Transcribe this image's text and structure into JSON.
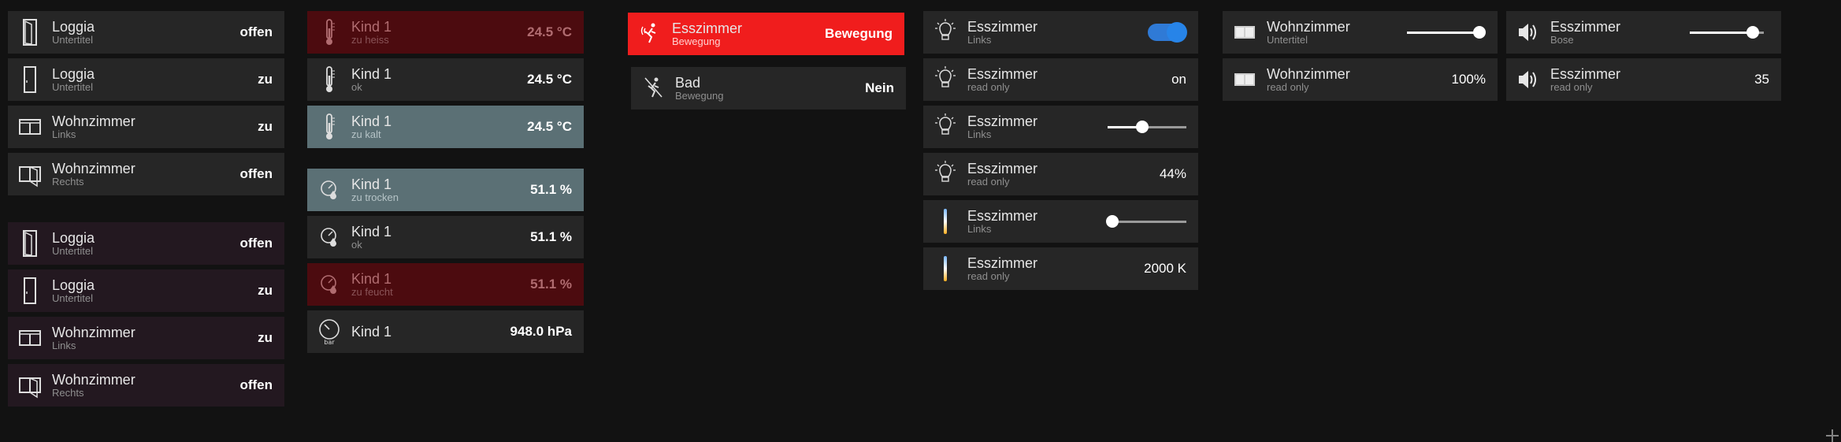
{
  "col1": [
    {
      "name": "Loggia",
      "sub": "Untertitel",
      "value": "offen",
      "icon": "door-open-icon"
    },
    {
      "name": "Loggia",
      "sub": "Untertitel",
      "value": "zu",
      "icon": "door-closed-icon"
    },
    {
      "name": "Wohnzimmer",
      "sub": "Links",
      "value": "zu",
      "icon": "window-closed-icon"
    },
    {
      "name": "Wohnzimmer",
      "sub": "Rechts",
      "value": "offen",
      "icon": "window-open-icon"
    }
  ],
  "col1b": [
    {
      "name": "Loggia",
      "sub": "Untertitel",
      "value": "offen",
      "icon": "door-open-icon"
    },
    {
      "name": "Loggia",
      "sub": "Untertitel",
      "value": "zu",
      "icon": "door-closed-icon"
    },
    {
      "name": "Wohnzimmer",
      "sub": "Links",
      "value": "zu",
      "icon": "window-closed-icon"
    },
    {
      "name": "Wohnzimmer",
      "sub": "Rechts",
      "value": "offen",
      "icon": "window-open-icon"
    }
  ],
  "col2": [
    {
      "name": "Kind 1",
      "sub": "zu heiss",
      "value": "24.5 °C",
      "icon": "thermometer-icon"
    },
    {
      "name": "Kind 1",
      "sub": "ok",
      "value": "24.5 °C",
      "icon": "thermometer-icon"
    },
    {
      "name": "Kind 1",
      "sub": "zu kalt",
      "value": "24.5 °C",
      "icon": "thermometer-icon"
    }
  ],
  "col2b": [
    {
      "name": "Kind 1",
      "sub": "zu trocken",
      "value": "51.1 %",
      "icon": "humidity-icon"
    },
    {
      "name": "Kind 1",
      "sub": "ok",
      "value": "51.1 %",
      "icon": "humidity-icon"
    },
    {
      "name": "Kind 1",
      "sub": "zu feucht",
      "value": "51.1 %",
      "icon": "humidity-icon"
    },
    {
      "name": "Kind 1",
      "sub": "",
      "value": "948.0 hPa",
      "icon": "barometer-icon",
      "icon_text": "bar"
    }
  ],
  "motion": [
    {
      "name": "Esszimmer",
      "sub": "Bewegung",
      "value": "Bewegung",
      "icon": "motion-active-icon"
    },
    {
      "name": "Bad",
      "sub": "Bewegung",
      "value": "Nein",
      "icon": "motion-inactive-icon"
    }
  ],
  "lights": [
    {
      "name": "Esszimmer",
      "sub": "Links",
      "control": "toggle",
      "state": "on",
      "icon": "light-bulb-icon"
    },
    {
      "name": "Esszimmer",
      "sub": "read only",
      "value": "on",
      "icon": "light-bulb-icon"
    },
    {
      "name": "Esszimmer",
      "sub": "Links",
      "control": "slider",
      "level": 0.44,
      "icon": "light-bulb-icon"
    },
    {
      "name": "Esszimmer",
      "sub": "read only",
      "value": "44%",
      "icon": "light-bulb-icon"
    },
    {
      "name": "Esszimmer",
      "sub": "Links",
      "control": "slider",
      "level": 0.0,
      "icon": "color-temperature-icon"
    },
    {
      "name": "Esszimmer",
      "sub": "read only",
      "value": "2000 K",
      "icon": "color-temperature-icon"
    }
  ],
  "blinds": [
    {
      "name": "Wohnzimmer",
      "sub": "Untertitel",
      "control": "slider",
      "level": 1.0,
      "icon": "blinds-icon"
    },
    {
      "name": "Wohnzimmer",
      "sub": "read only",
      "value": "100%",
      "icon": "blinds-icon"
    }
  ],
  "audio": [
    {
      "name": "Esszimmer",
      "sub": "Bose",
      "control": "slider",
      "level": 0.85,
      "icon": "speaker-icon"
    },
    {
      "name": "Esszimmer",
      "sub": "read only",
      "value": "35",
      "icon": "speaker-icon"
    }
  ],
  "colors": {
    "hot": "#4c0b0f",
    "cold": "#5b7075",
    "alarm": "#f01d1d",
    "toggle": "#2784e8",
    "purple": "#231820"
  }
}
